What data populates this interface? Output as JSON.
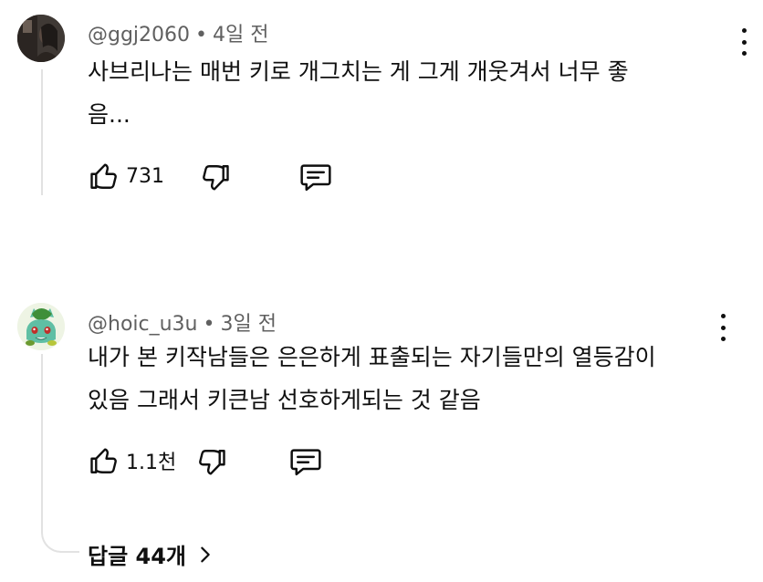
{
  "comments": [
    {
      "handle": "@ggj2060",
      "separator": "•",
      "time": "4일 전",
      "lines": [
        "사브리나는 매번 키로 개그치는 게 그게 개웃겨서 너무 좋",
        "음..."
      ],
      "likes": "731",
      "avatar_icon": "user-avatar-photo"
    },
    {
      "handle": "@hoic_u3u",
      "separator": "•",
      "time": "3일 전",
      "lines": [
        "내가 본 키작남들은 은은하게 표출되는 자기들만의 열등감이",
        "있음 그래서 키큰남 선호하게되는 것 같음"
      ],
      "likes": "1.1천",
      "avatar_icon": "bulbasaur-avatar"
    }
  ],
  "replies": {
    "label": "답글 44개",
    "icon": "chevron-right-icon"
  },
  "colors": {
    "meta_text": "#606060",
    "thread_line": "#e2e2e2",
    "text": "#0f0f0f"
  }
}
